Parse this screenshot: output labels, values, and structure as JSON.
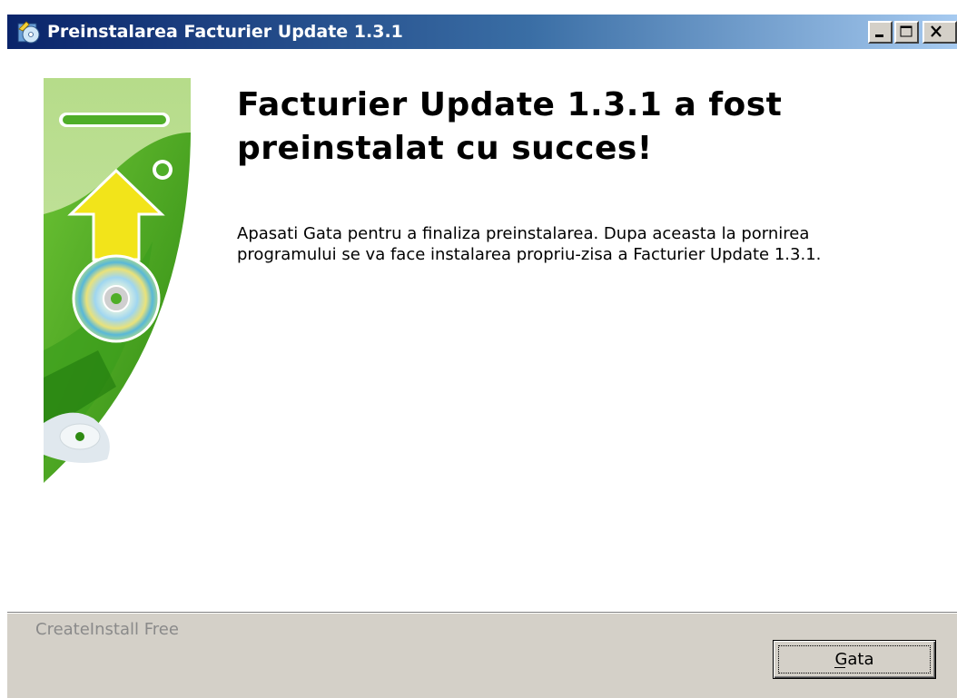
{
  "window": {
    "title": "Preinstalarea Facturier Update 1.3.1",
    "controls": {
      "minimize": "minimize-icon",
      "maximize": "maximize-icon",
      "close": "close-icon"
    }
  },
  "content": {
    "heading": "Facturier Update 1.3.1 a fost preinstalat cu succes!",
    "body": "Apasati Gata pentru a finaliza preinstalarea. Dupa aceasta la pornirea programului se va face instalarea propriu-zisa a Facturier Update 1.3.1."
  },
  "footer": {
    "brand": "CreateInstall Free",
    "finish_button": "Gata"
  },
  "colors": {
    "titlebar_start": "#0a246a",
    "titlebar_end": "#a6caf0",
    "panel": "#d4d0c8",
    "banner_green": "#5cb82e",
    "arrow_yellow": "#f2e41a"
  }
}
